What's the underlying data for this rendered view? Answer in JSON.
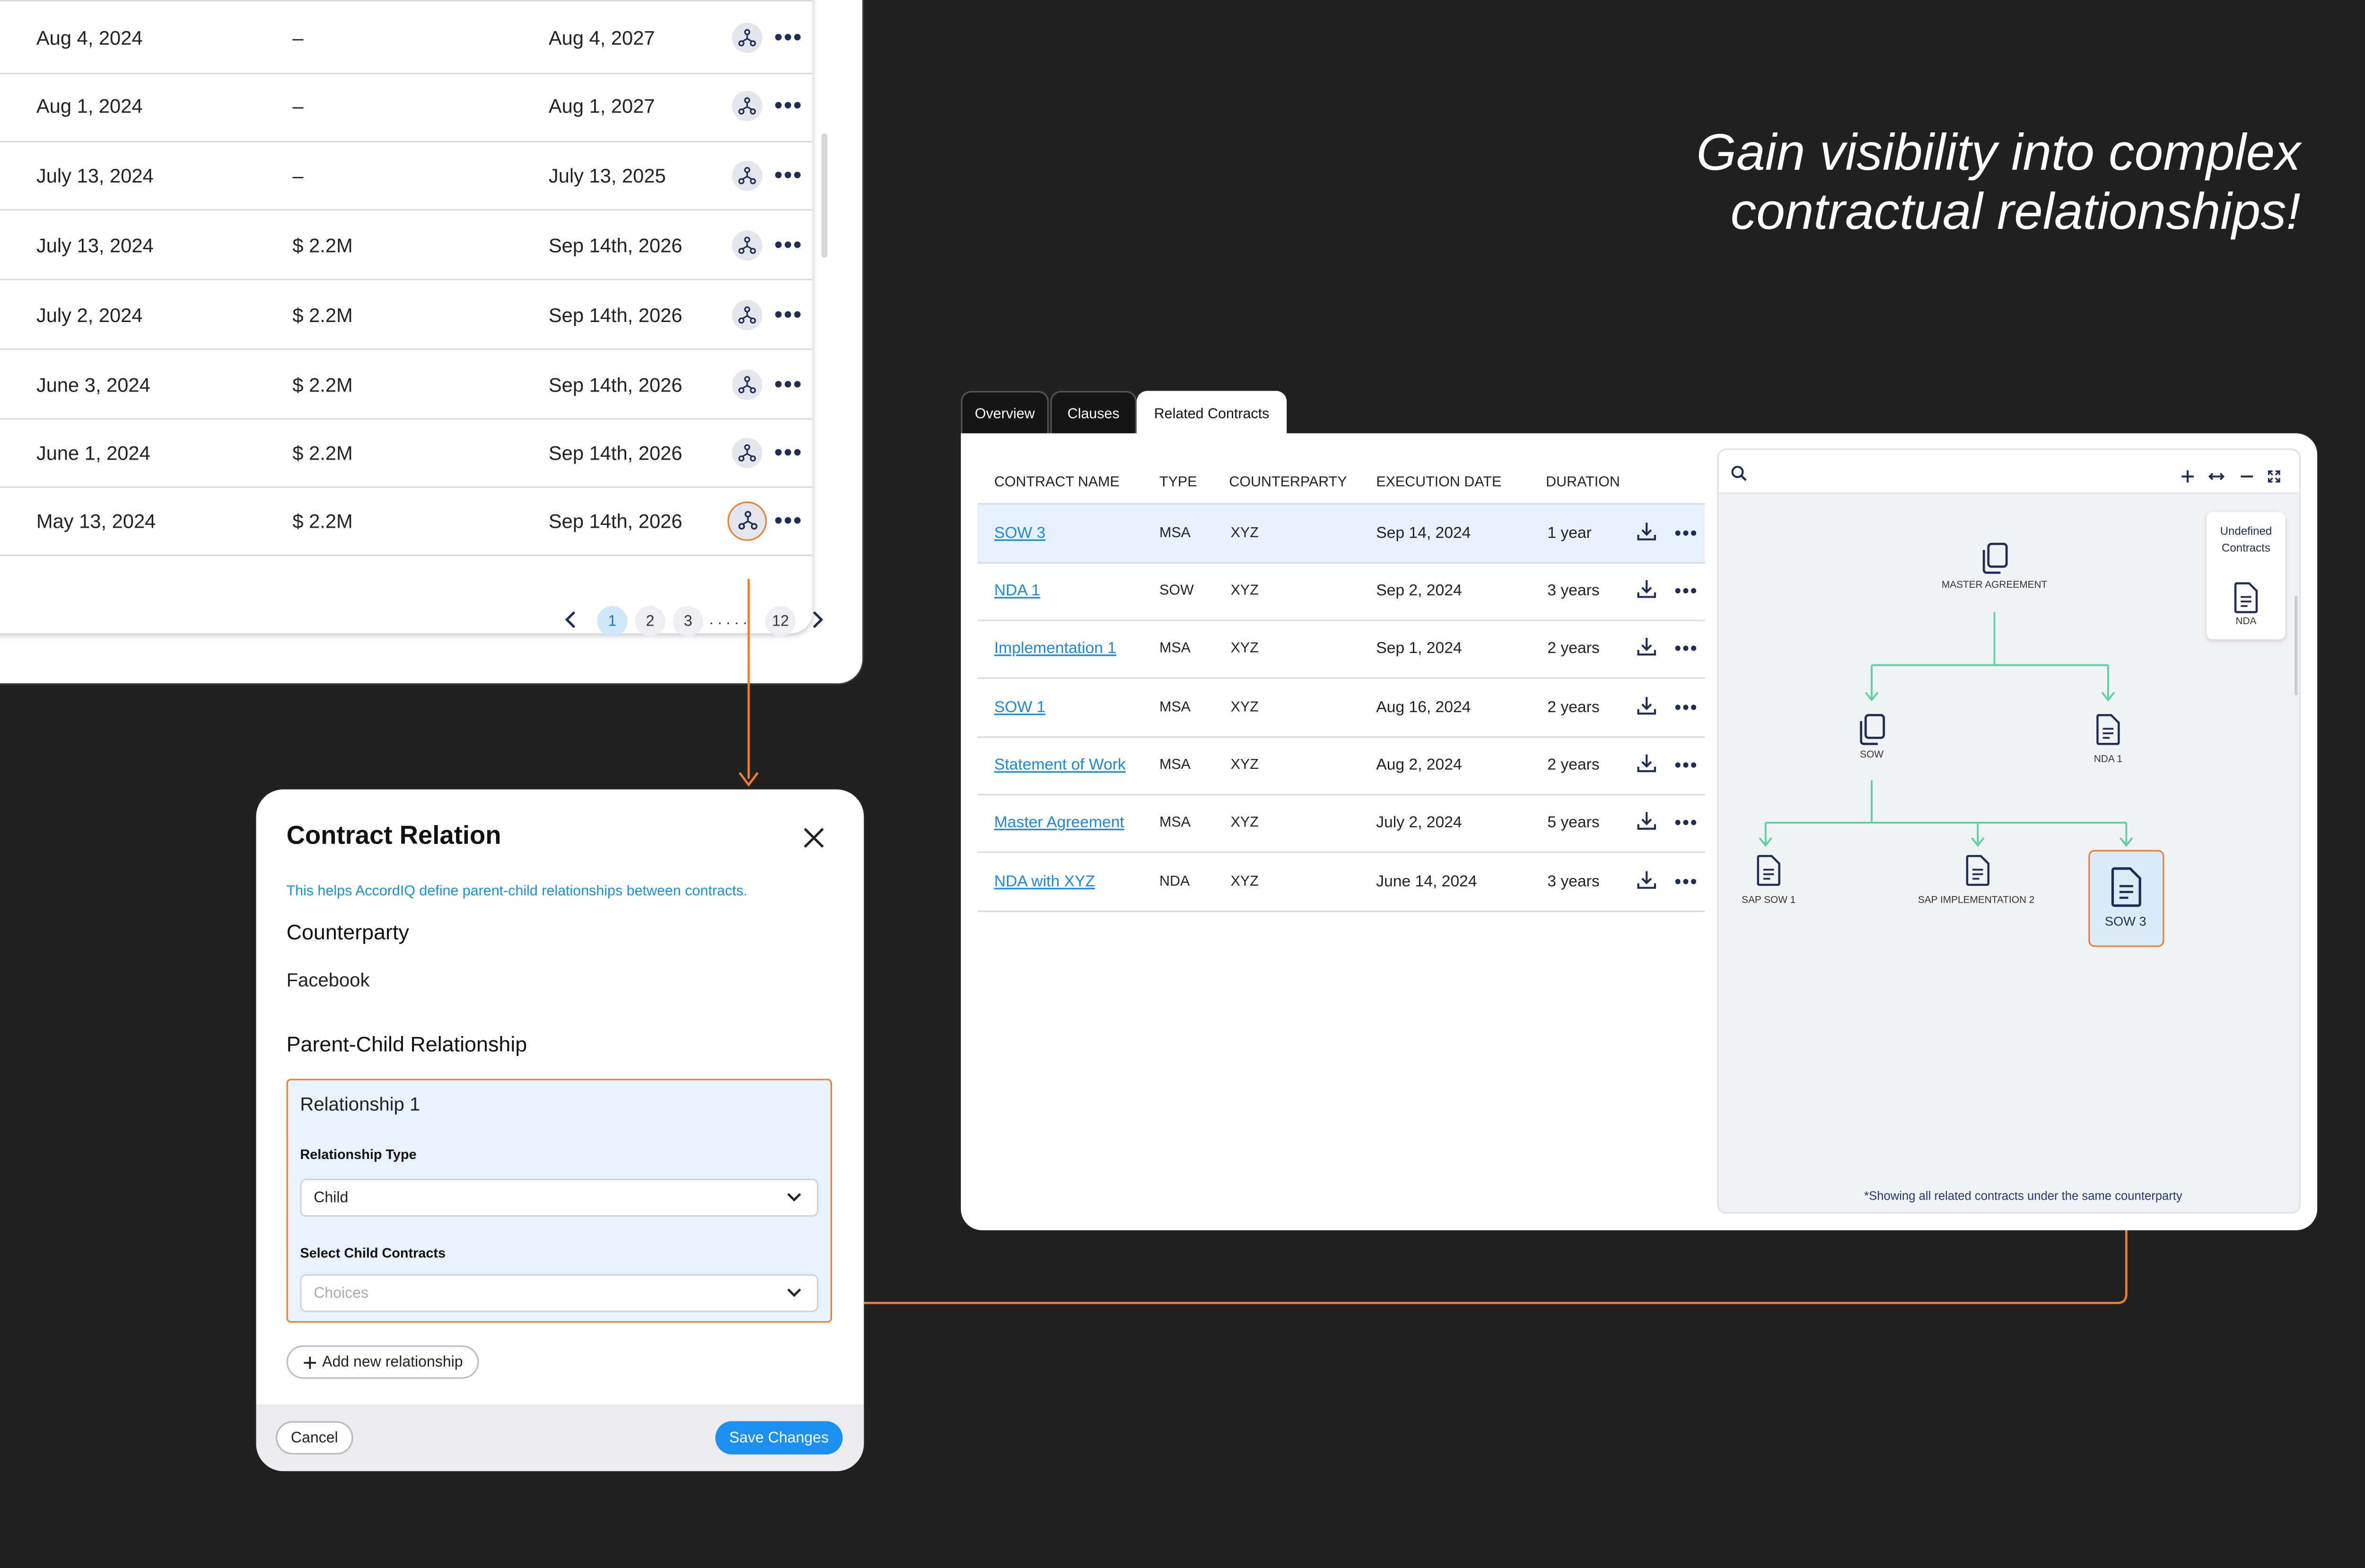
{
  "headline": [
    "Gain visibility into complex",
    "contractual relationships!"
  ],
  "list": {
    "rows": [
      {
        "date": "Aug 4, 2024",
        "value": "–",
        "end": "Aug 4, 2027"
      },
      {
        "date": "Aug 1, 2024",
        "value": "–",
        "end": "Aug 1, 2027"
      },
      {
        "date": "July 13, 2024",
        "value": "–",
        "end": "July 13, 2025"
      },
      {
        "date": "July 13, 2024",
        "value": "$ 2.2M",
        "end": "Sep 14th, 2026"
      },
      {
        "date": "July 2, 2024",
        "value": "$ 2.2M",
        "end": "Sep 14th, 2026"
      },
      {
        "date": "June 3, 2024",
        "value": "$ 2.2M",
        "end": "Sep 14th, 2026"
      },
      {
        "date": "June 1, 2024",
        "value": "$ 2.2M",
        "end": "Sep 14th, 2026"
      },
      {
        "date": "May 13, 2024",
        "value": "$ 2.2M",
        "end": "Sep 14th, 2026"
      }
    ],
    "pagination": {
      "pages": [
        "1",
        "2",
        "3"
      ],
      "ellipsis": ". . . . .",
      "last": "12",
      "current": "1"
    }
  },
  "modal": {
    "title": "Contract Relation",
    "helper": "This helps AccordIQ define parent-child relationships between contracts.",
    "counterparty_label": "Counterparty",
    "counterparty_value": "Facebook",
    "section_title": "Parent-Child Relationship",
    "relationship": {
      "title": "Relationship 1",
      "type_label": "Relationship Type",
      "type_value": "Child",
      "child_label": "Select Child Contracts",
      "child_placeholder": "Choices"
    },
    "add_button": "Add new relationship",
    "cancel_button": "Cancel",
    "save_button": "Save Changes"
  },
  "tabs": [
    "Overview",
    "Clauses",
    "Related Contracts"
  ],
  "active_tab": "Related Contracts",
  "table": {
    "headers": [
      "CONTRACT NAME",
      "TYPE",
      "COUNTERPARTY",
      "EXECUTION DATE",
      "DURATION"
    ],
    "rows": [
      {
        "name": "SOW 3",
        "type": "MSA",
        "counterparty": "XYZ",
        "date": "Sep 14, 2024",
        "duration": "1 year"
      },
      {
        "name": "NDA 1",
        "type": "SOW",
        "counterparty": "XYZ",
        "date": "Sep 2, 2024",
        "duration": "3 years"
      },
      {
        "name": "Implementation 1",
        "type": "MSA",
        "counterparty": "XYZ",
        "date": "Sep 1, 2024",
        "duration": "2 years"
      },
      {
        "name": "SOW 1",
        "type": "MSA",
        "counterparty": "XYZ",
        "date": "Aug 16, 2024",
        "duration": "2 years"
      },
      {
        "name": "Statement of Work",
        "type": "MSA",
        "counterparty": "XYZ",
        "date": "Aug 2, 2024",
        "duration": "2 years"
      },
      {
        "name": "Master Agreement",
        "type": "MSA",
        "counterparty": "XYZ",
        "date": "July 2, 2024",
        "duration": "5 years"
      },
      {
        "name": "NDA with XYZ",
        "type": "NDA",
        "counterparty": "XYZ",
        "date": "June 14, 2024",
        "duration": "3 years"
      }
    ]
  },
  "graph": {
    "nodes": {
      "master": "MASTER AGREEMENT",
      "sow": "SOW",
      "nda1": "NDA 1",
      "sap_sow1": "SAP SOW 1",
      "sap_impl2": "SAP IMPLEMENTATION 2",
      "sow3": "SOW 3"
    },
    "undefined_title": "Undefined Contracts",
    "undefined_item": "NDA",
    "note": "*Showing all related contracts under the same counterparty",
    "toolbar_icons": [
      "search-icon",
      "zoom-in-icon",
      "fit-width-icon",
      "zoom-out-icon",
      "fullscreen-icon"
    ]
  },
  "colors": {
    "accent": "#ee7d34",
    "primary": "#1d8ff0",
    "tree_line": "#5fd0a0",
    "background": "#212122"
  }
}
